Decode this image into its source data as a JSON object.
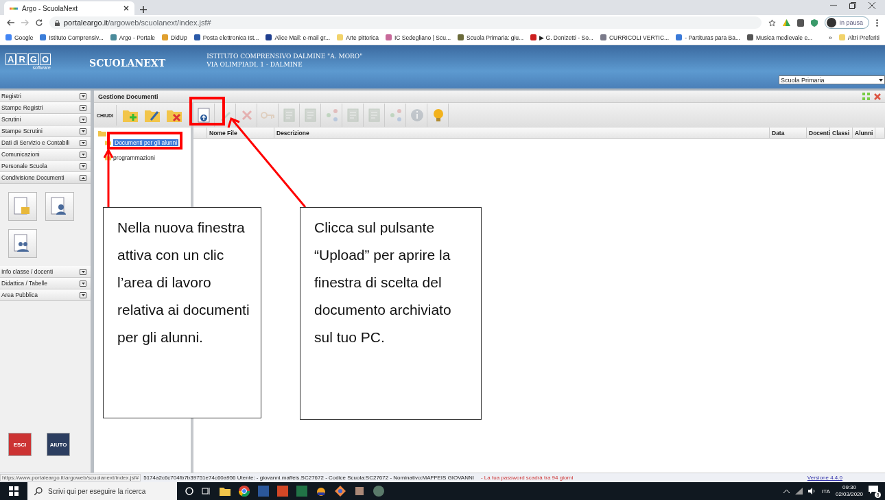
{
  "browser": {
    "tab": {
      "title": "Argo - ScuolaNext",
      "selected": true
    },
    "address": {
      "host": "portaleargo.it",
      "path": "/argoweb/scuolanext/index.jsf#"
    },
    "profile": "In pausa",
    "bookmarks": [
      {
        "label": "Google",
        "color": "#4285f4"
      },
      {
        "label": "Istituto Comprensiv...",
        "color": "#3b7dd8"
      },
      {
        "label": "Argo - Portale",
        "color": "#4a8a9a"
      },
      {
        "label": "DidUp",
        "color": "#e0a030"
      },
      {
        "label": "Posta elettronica Ist...",
        "color": "#2b5aa8"
      },
      {
        "label": "Alice Mail: e-mail gr...",
        "color": "#1f3f8f"
      },
      {
        "label": "Arte pittorica",
        "color": "#f2d36b"
      },
      {
        "label": "IC Sedegliano | Scu...",
        "color": "#c86a9a"
      },
      {
        "label": "Scuola Primaria: giu...",
        "color": "#6b6b3a"
      },
      {
        "label": "▶ G. Donizetti - So...",
        "color": "#cc1f1f"
      },
      {
        "label": "CURRICOLI VERTIC...",
        "color": "#7a7a8a"
      },
      {
        "label": "- Partituras para Ba...",
        "color": "#3a7ad8"
      },
      {
        "label": "Musica medievale e...",
        "color": "#555555"
      }
    ],
    "more": "»",
    "other_bookmarks": "Altri Preferiti"
  },
  "header": {
    "logo": [
      "A",
      "R",
      "G",
      "O"
    ],
    "logo_sub": "software",
    "product": "SCUOLANEXT",
    "school": "ISTITUTO COMPRENSIVO DALMINE \"A. MORO\"",
    "address": "VIA OLIMPIADI, 1 - DALMINE",
    "school_select": "Scuola Primaria"
  },
  "sidebar": {
    "items": [
      {
        "label": "Registri",
        "expanded": false
      },
      {
        "label": "Stampe Registri",
        "expanded": false
      },
      {
        "label": "Scrutini",
        "expanded": false
      },
      {
        "label": "Stampe Scrutini",
        "expanded": false
      },
      {
        "label": "Dati di Servizio e Contabili",
        "expanded": false
      },
      {
        "label": "Comunicazioni",
        "expanded": false
      },
      {
        "label": "Personale Scuola",
        "expanded": false
      },
      {
        "label": "Condivisione Documenti",
        "expanded": true
      },
      {
        "label": "Info classe / docenti",
        "expanded": false
      },
      {
        "label": "Didattica / Tabelle",
        "expanded": false
      },
      {
        "label": "Area Pubblica",
        "expanded": false
      }
    ],
    "exit": "ESCI",
    "help": "AIUTO"
  },
  "panel": {
    "title": "Gestione Documenti",
    "close_tree": "CHIUDI",
    "tree": [
      {
        "label": "Documenti per gli alunni",
        "selected": true
      },
      {
        "label": "programmazioni",
        "selected": false
      }
    ],
    "toolbar": [
      {
        "kind": "upload",
        "disabled": false
      },
      {
        "kind": "edit",
        "disabled": true
      },
      {
        "kind": "delete",
        "disabled": true
      },
      {
        "kind": "key",
        "disabled": true
      },
      {
        "kind": "doc",
        "disabled": true
      },
      {
        "kind": "doc",
        "disabled": true
      },
      {
        "kind": "share",
        "disabled": true
      },
      {
        "kind": "doc",
        "disabled": true
      },
      {
        "kind": "doc",
        "disabled": true
      },
      {
        "kind": "share",
        "disabled": true
      },
      {
        "kind": "info",
        "disabled": true
      },
      {
        "kind": "bulb",
        "disabled": false
      }
    ],
    "columns": [
      "Nome File",
      "Descrizione",
      "Data",
      "Docenti",
      "Classi",
      "Alunni"
    ]
  },
  "status_bar": {
    "link_preview": "https://www.portaleargo.it/argoweb/scuolanext/index.jsf#",
    "info": "5174a2c6c704fb7b39751e74c60a956 Utente: - giovanni.maffeis.SC27672 - Codice Scuola:SC27672 - Nominativo:MAFFEIS GIOVANNI",
    "warning": "- La tua password scadrà tra 94 giorni",
    "version": "Versione 4.4.0"
  },
  "taskbar": {
    "search": "Scrivi qui per eseguire la ricerca",
    "language": "ITA",
    "time": "09:30",
    "date": "02/03/2020",
    "notifications": "8"
  },
  "annotations": [
    {
      "text": "Nella nuova finestra attiva con un clic l’area di lavoro relativa ai documenti per gli alunni."
    },
    {
      "text": "Clicca sul pulsante “Upload” per aprire la finestra di scelta del documento archiviato sul tuo PC."
    }
  ]
}
